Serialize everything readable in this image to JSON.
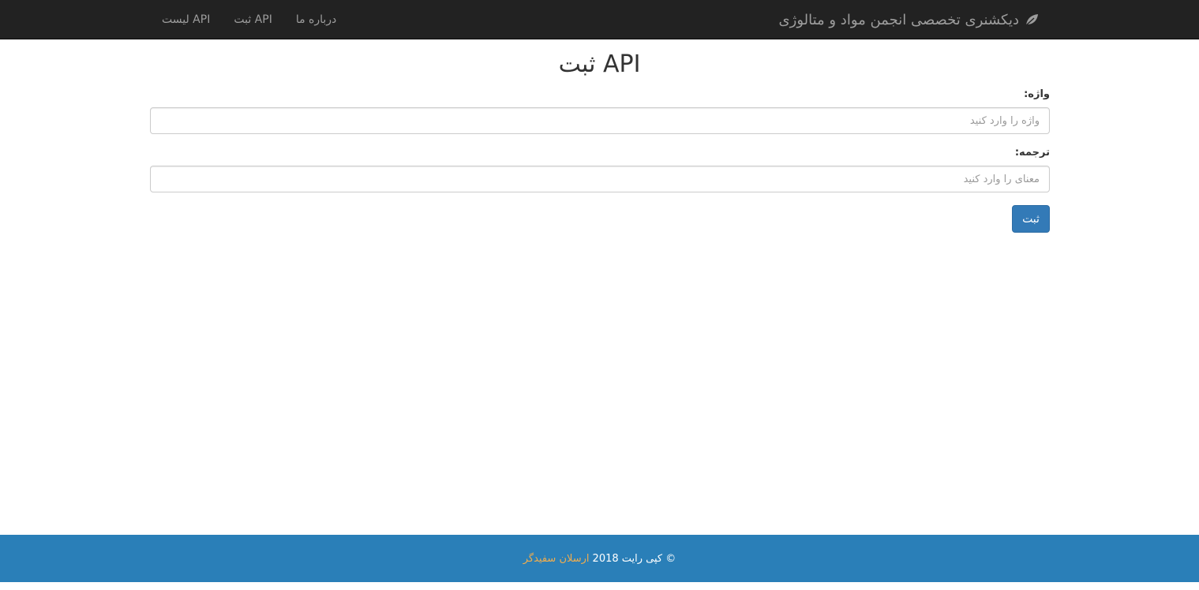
{
  "navbar": {
    "brand_label": "دیکشنری تخصصی انجمن مواد و متالوژی",
    "brand_icon": "leaf-icon",
    "links": [
      {
        "label": "درباره ما"
      },
      {
        "label": "ثبت API"
      },
      {
        "label": "لیست API"
      }
    ]
  },
  "page": {
    "title": "ثبت API"
  },
  "form": {
    "word_label": "واژه:",
    "word_placeholder": "واژه را وارد کنید",
    "word_value": "",
    "translation_label": "ترجمه:",
    "translation_placeholder": "معنای را وارد کنید",
    "translation_value": "",
    "submit_label": "ثبت"
  },
  "footer": {
    "copyright_text": "© کپی رایت 2018",
    "author_name": "ارسلان سفیدگر"
  },
  "colors": {
    "navbar_bg": "#222222",
    "primary": "#337ab7",
    "footer_bg": "#2a7fb8",
    "author_link": "#f0ad4e"
  }
}
